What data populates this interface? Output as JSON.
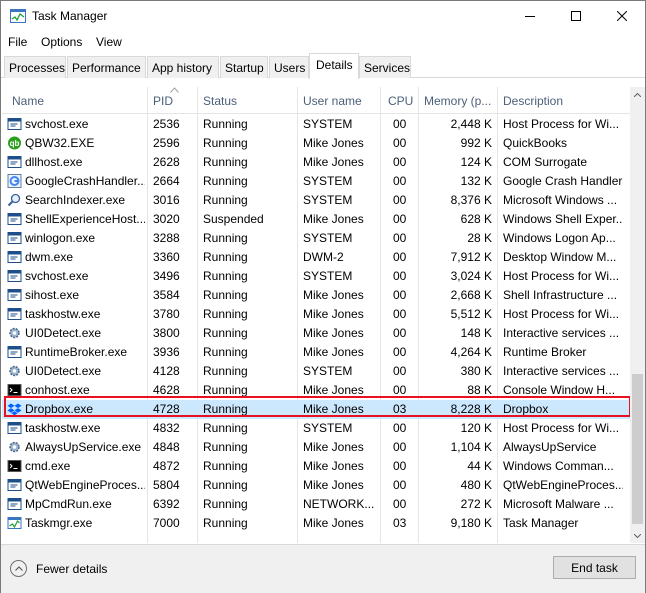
{
  "window": {
    "title": "Task Manager"
  },
  "menu": [
    "File",
    "Options",
    "View"
  ],
  "tabs": [
    "Processes",
    "Performance",
    "App history",
    "Startup",
    "Users",
    "Details",
    "Services"
  ],
  "active_tab": "Details",
  "columns": [
    "Name",
    "PID",
    "Status",
    "User name",
    "CPU",
    "Memory (p...",
    "Description"
  ],
  "sort_column": "PID",
  "rows": [
    {
      "icon": "window-icon",
      "name": "svchost.exe",
      "pid": "2536",
      "status": "Running",
      "user": "SYSTEM",
      "cpu": "00",
      "mem": "2,448 K",
      "desc": "Host Process for Wi..."
    },
    {
      "icon": "quickbooks-icon",
      "name": "QBW32.EXE",
      "pid": "2596",
      "status": "Running",
      "user": "Mike Jones",
      "cpu": "00",
      "mem": "992 K",
      "desc": "QuickBooks"
    },
    {
      "icon": "window-icon",
      "name": "dllhost.exe",
      "pid": "2628",
      "status": "Running",
      "user": "Mike Jones",
      "cpu": "00",
      "mem": "124 K",
      "desc": "COM Surrogate"
    },
    {
      "icon": "google-icon",
      "name": "GoogleCrashHandler...",
      "pid": "2664",
      "status": "Running",
      "user": "SYSTEM",
      "cpu": "00",
      "mem": "132 K",
      "desc": "Google Crash Handler"
    },
    {
      "icon": "search-icon",
      "name": "SearchIndexer.exe",
      "pid": "3016",
      "status": "Running",
      "user": "SYSTEM",
      "cpu": "00",
      "mem": "8,376 K",
      "desc": "Microsoft Windows ..."
    },
    {
      "icon": "window-icon",
      "name": "ShellExperienceHost....",
      "pid": "3020",
      "status": "Suspended",
      "user": "Mike Jones",
      "cpu": "00",
      "mem": "628 K",
      "desc": "Windows Shell Exper..."
    },
    {
      "icon": "window-icon",
      "name": "winlogon.exe",
      "pid": "3288",
      "status": "Running",
      "user": "SYSTEM",
      "cpu": "00",
      "mem": "28 K",
      "desc": "Windows Logon Ap..."
    },
    {
      "icon": "window-icon",
      "name": "dwm.exe",
      "pid": "3360",
      "status": "Running",
      "user": "DWM-2",
      "cpu": "00",
      "mem": "7,912 K",
      "desc": "Desktop Window M..."
    },
    {
      "icon": "window-icon",
      "name": "svchost.exe",
      "pid": "3496",
      "status": "Running",
      "user": "SYSTEM",
      "cpu": "00",
      "mem": "3,024 K",
      "desc": "Host Process for Wi..."
    },
    {
      "icon": "window-icon",
      "name": "sihost.exe",
      "pid": "3584",
      "status": "Running",
      "user": "Mike Jones",
      "cpu": "00",
      "mem": "2,668 K",
      "desc": "Shell Infrastructure ..."
    },
    {
      "icon": "window-icon",
      "name": "taskhostw.exe",
      "pid": "3780",
      "status": "Running",
      "user": "Mike Jones",
      "cpu": "00",
      "mem": "5,512 K",
      "desc": "Host Process for Wi..."
    },
    {
      "icon": "gear-icon",
      "name": "UI0Detect.exe",
      "pid": "3800",
      "status": "Running",
      "user": "Mike Jones",
      "cpu": "00",
      "mem": "148 K",
      "desc": "Interactive services ..."
    },
    {
      "icon": "window-icon",
      "name": "RuntimeBroker.exe",
      "pid": "3936",
      "status": "Running",
      "user": "Mike Jones",
      "cpu": "00",
      "mem": "4,264 K",
      "desc": "Runtime Broker"
    },
    {
      "icon": "gear-icon",
      "name": "UI0Detect.exe",
      "pid": "4128",
      "status": "Running",
      "user": "SYSTEM",
      "cpu": "00",
      "mem": "380 K",
      "desc": "Interactive services ..."
    },
    {
      "icon": "console-icon",
      "name": "conhost.exe",
      "pid": "4628",
      "status": "Running",
      "user": "Mike Jones",
      "cpu": "00",
      "mem": "88 K",
      "desc": "Console Window H..."
    },
    {
      "icon": "dropbox-icon",
      "name": "Dropbox.exe",
      "pid": "4728",
      "status": "Running",
      "user": "Mike Jones",
      "cpu": "03",
      "mem": "8,228 K",
      "desc": "Dropbox",
      "selected": true
    },
    {
      "icon": "window-icon",
      "name": "taskhostw.exe",
      "pid": "4832",
      "status": "Running",
      "user": "SYSTEM",
      "cpu": "00",
      "mem": "120 K",
      "desc": "Host Process for Wi..."
    },
    {
      "icon": "gear-icon",
      "name": "AlwaysUpService.exe",
      "pid": "4848",
      "status": "Running",
      "user": "Mike Jones",
      "cpu": "00",
      "mem": "1,104 K",
      "desc": "AlwaysUpService"
    },
    {
      "icon": "console-icon",
      "name": "cmd.exe",
      "pid": "4872",
      "status": "Running",
      "user": "Mike Jones",
      "cpu": "00",
      "mem": "44 K",
      "desc": "Windows Comman..."
    },
    {
      "icon": "window-icon",
      "name": "QtWebEngineProces...",
      "pid": "5804",
      "status": "Running",
      "user": "Mike Jones",
      "cpu": "00",
      "mem": "480 K",
      "desc": "QtWebEngineProces..."
    },
    {
      "icon": "window-icon",
      "name": "MpCmdRun.exe",
      "pid": "6392",
      "status": "Running",
      "user": "NETWORK...",
      "cpu": "00",
      "mem": "272 K",
      "desc": "Microsoft Malware ..."
    },
    {
      "icon": "taskmgr-icon",
      "name": "Taskmgr.exe",
      "pid": "7000",
      "status": "Running",
      "user": "Mike Jones",
      "cpu": "03",
      "mem": "9,180 K",
      "desc": "Task Manager"
    }
  ],
  "footer": {
    "fewer_details": "Fewer details",
    "end_task": "End task"
  },
  "colors": {
    "selection": "#cce8ff",
    "highlight_border": "#e81123",
    "header_text": "#4c607a"
  }
}
